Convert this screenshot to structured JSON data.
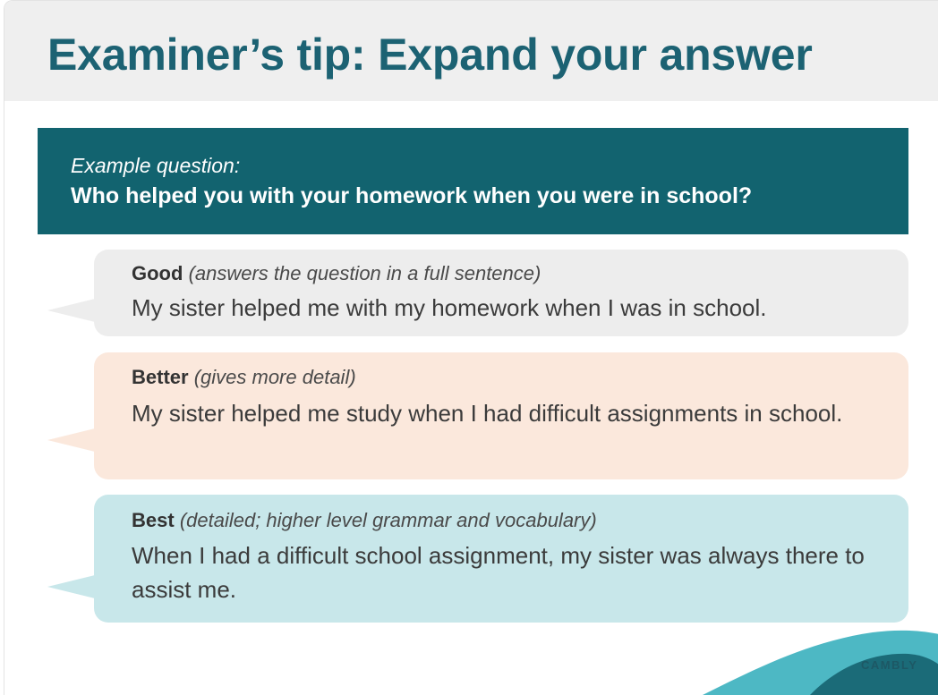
{
  "header": {
    "title": "Examiner’s tip: Expand your answer"
  },
  "question": {
    "label": "Example question:",
    "text": "Who helped you with your homework when you were in school?"
  },
  "answers": [
    {
      "grade": "Good",
      "note": "(answers the question in a full sentence)",
      "text": "My sister helped me with my homework when I was in school."
    },
    {
      "grade": "Better",
      "note": "(gives more detail)",
      "text": "My sister helped me study when I had difficult assignments in school."
    },
    {
      "grade": "Best",
      "note": "(detailed; higher level grammar and vocabulary)",
      "text": "When I had a difficult school assignment, my sister was always there to assist me."
    }
  ],
  "brand": {
    "name": "CAMBLY"
  },
  "colors": {
    "title": "#1c6273",
    "question_bg": "#12636f",
    "good_bg": "#ededed",
    "better_bg": "#fbe8dc",
    "best_bg": "#c8e7ea"
  }
}
